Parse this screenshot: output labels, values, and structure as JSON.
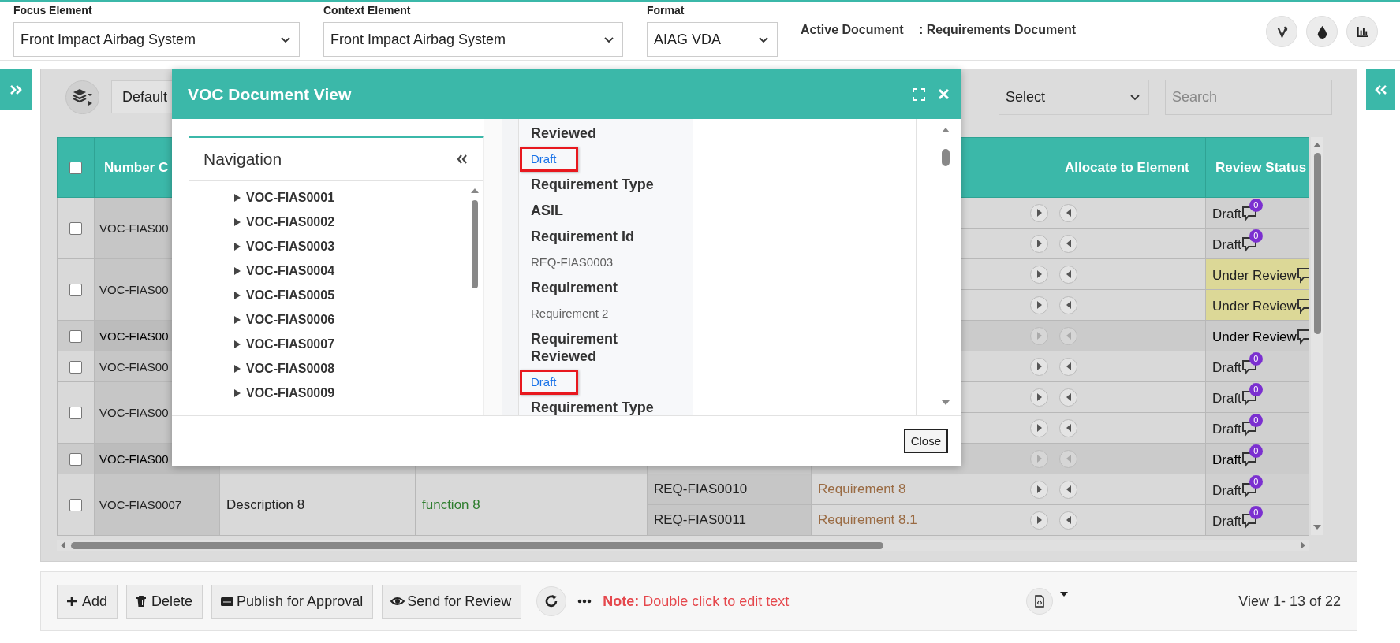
{
  "header": {
    "fields": [
      {
        "label": "Focus Element",
        "value": "Front Impact Airbag System"
      },
      {
        "label": "Context Element",
        "value": "Front Impact Airbag System"
      },
      {
        "label": "Format",
        "value": "AIAG VDA"
      }
    ],
    "active_document": {
      "label": "Active Document",
      "value": ": Requirements Document"
    }
  },
  "toolbar": {
    "view_select": "Default",
    "filter_select": "Select",
    "search": {
      "placeholder": "Search"
    }
  },
  "table": {
    "select_all": {
      "checked": false
    },
    "columns": [
      {
        "kind": "number",
        "label": "Number C"
      },
      {
        "kind": "description"
      },
      {
        "kind": "function"
      },
      {
        "kind": "req_id"
      },
      {
        "kind": "requirement"
      },
      {
        "kind": "allocate",
        "label": "Allocate to Element"
      },
      {
        "kind": "status",
        "label": "Review Status"
      }
    ],
    "groups": [
      {
        "number": "VOC-FIAS00",
        "checked": false,
        "highlighted": false,
        "rows": [
          {
            "status": "Draft",
            "comments": "0",
            "flagged": false
          },
          {
            "status": "Draft",
            "comments": "0",
            "flagged": false
          }
        ]
      },
      {
        "number": "VOC-FIAS00",
        "checked": false,
        "highlighted": false,
        "rows": [
          {
            "status": "Under Review",
            "flagged": true
          },
          {
            "status": "Under Review",
            "flagged": true
          }
        ]
      },
      {
        "number": "VOC-FIAS00",
        "checked": false,
        "highlighted": true,
        "rows": [
          {
            "status": "Under Review",
            "flagged": false
          }
        ]
      },
      {
        "number": "VOC-FIAS00",
        "checked": false,
        "highlighted": false,
        "rows": [
          {
            "status": "Draft",
            "comments": "0",
            "flagged": false
          }
        ]
      },
      {
        "number": "VOC-FIAS00",
        "checked": false,
        "highlighted": false,
        "rows": [
          {
            "status": "Draft",
            "comments": "0",
            "flagged": false
          },
          {
            "status": "Draft",
            "comments": "0",
            "flagged": false
          }
        ]
      },
      {
        "number": "VOC-FIAS00",
        "checked": false,
        "highlighted": true,
        "rows": [
          {
            "status": "Draft",
            "comments": "0",
            "flagged": false
          }
        ]
      },
      {
        "number": "VOC-FIAS0007",
        "description": "Description 8",
        "function": "function 8",
        "checked": false,
        "highlighted": false,
        "rows": [
          {
            "req_id": "REQ-FIAS0010",
            "requirement": "Requirement 8",
            "status": "Draft",
            "comments": "0",
            "flagged": false
          },
          {
            "req_id": "REQ-FIAS0011",
            "requirement": "Requirement 8.1",
            "status": "Draft",
            "comments": "0",
            "flagged": false
          }
        ]
      }
    ]
  },
  "modal": {
    "title": "VOC Document View",
    "navigation": {
      "title": "Navigation",
      "items": [
        {
          "label": "VOC-FIAS0001",
          "expanded": false
        },
        {
          "label": "VOC-FIAS0002",
          "expanded": false
        },
        {
          "label": "VOC-FIAS0003",
          "expanded": false
        },
        {
          "label": "VOC-FIAS0004",
          "expanded": false
        },
        {
          "label": "VOC-FIAS0005",
          "expanded": false
        },
        {
          "label": "VOC-FIAS0006",
          "expanded": false
        },
        {
          "label": "VOC-FIAS0007",
          "expanded": false
        },
        {
          "label": "VOC-FIAS0008",
          "expanded": false
        },
        {
          "label": "VOC-FIAS0009",
          "expanded": false
        }
      ]
    },
    "fields": [
      {
        "label": "Reviewed",
        "value": "Draft",
        "kind": "status",
        "marked": true
      },
      {
        "label": "Requirement Type"
      },
      {
        "label": "ASIL"
      },
      {
        "label": "Requirement Id",
        "value": "REQ-FIAS0003",
        "kind": "text",
        "marked": false
      },
      {
        "label": "Requirement",
        "value": "Requirement 2",
        "kind": "text",
        "marked": false
      },
      {
        "label": "Requirement Reviewed",
        "value": "Draft",
        "kind": "status",
        "marked": true
      },
      {
        "label": "Requirement Type"
      }
    ],
    "close_button": "Close"
  },
  "actions": {
    "buttons": [
      {
        "kind": "plus",
        "label": "Add"
      },
      {
        "kind": "trash",
        "label": "Delete"
      },
      {
        "kind": "card",
        "label": "Publish for Approval"
      },
      {
        "kind": "eye",
        "label": "Send for Review"
      }
    ],
    "note": "**Note:** Double click to edit text",
    "pager": "View 1- 13 of 22"
  }
}
